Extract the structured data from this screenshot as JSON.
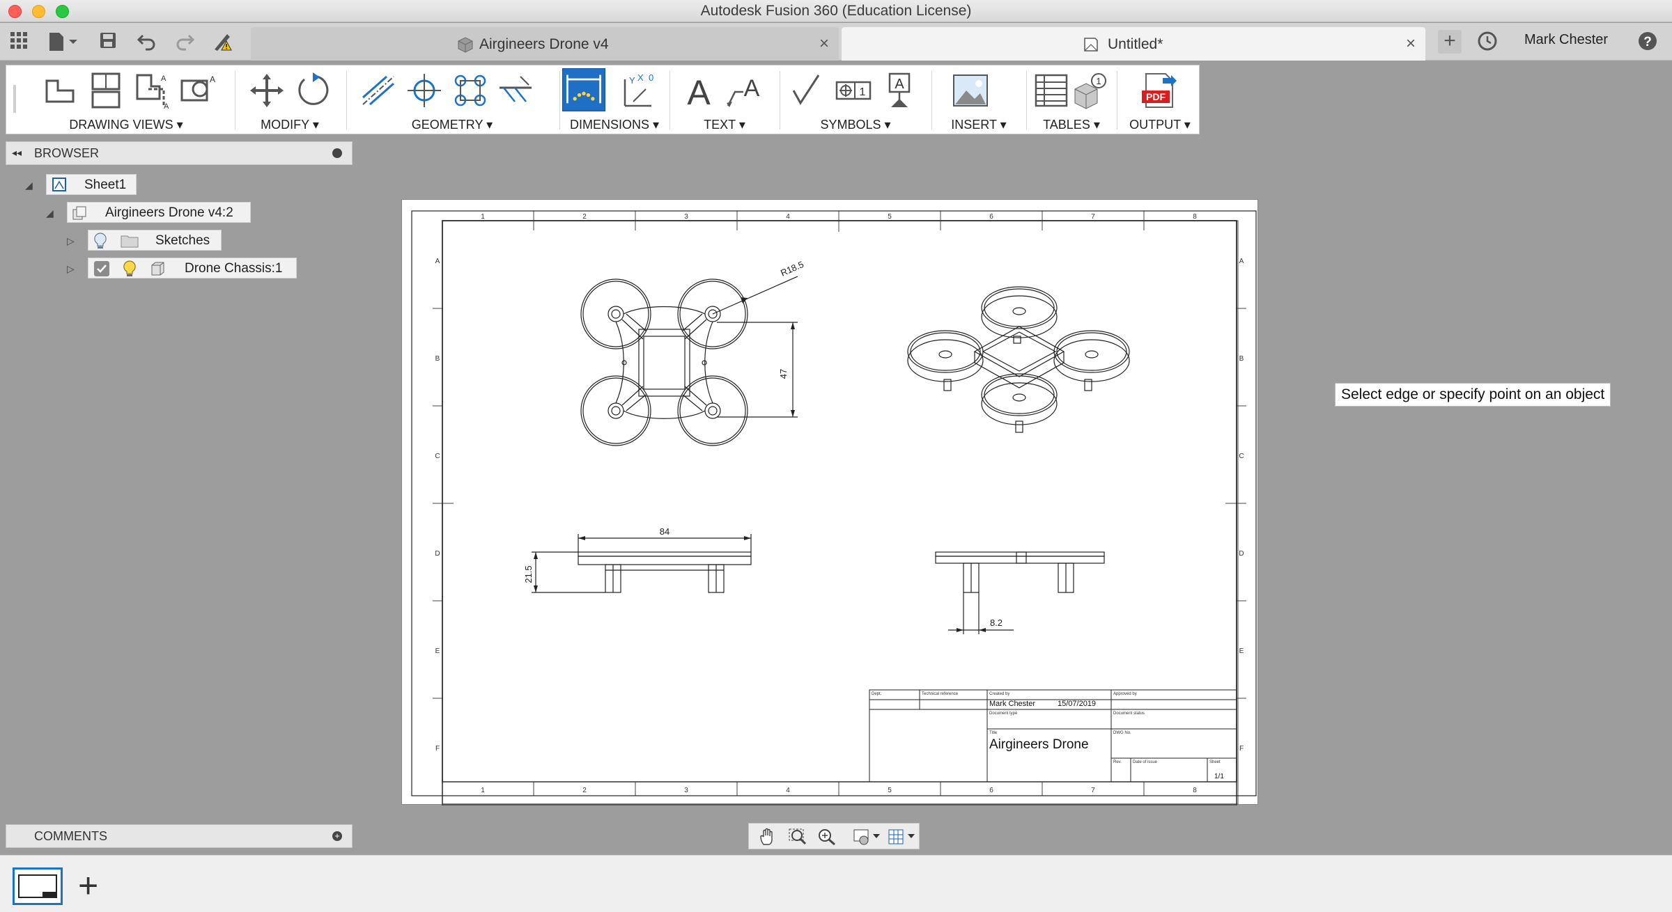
{
  "window": {
    "title": "Autodesk Fusion 360 (Education License)"
  },
  "tabs": [
    {
      "label": "Airgineers Drone v4",
      "active": false
    },
    {
      "label": "Untitled*",
      "active": true
    }
  ],
  "user": {
    "name": "Mark Chester"
  },
  "toolbar": {
    "groups": [
      {
        "label": "DRAWING VIEWS ▾"
      },
      {
        "label": "MODIFY ▾"
      },
      {
        "label": "GEOMETRY ▾"
      },
      {
        "label": "DIMENSIONS ▾"
      },
      {
        "label": "TEXT ▾"
      },
      {
        "label": "SYMBOLS ▾"
      },
      {
        "label": "INSERT ▾"
      },
      {
        "label": "TABLES ▾"
      },
      {
        "label": "OUTPUT ▾"
      }
    ],
    "pdf_label": "PDF",
    "text_glyph": "A"
  },
  "browser": {
    "title": "BROWSER",
    "nodes": [
      {
        "label": "Sheet1"
      },
      {
        "label": "Airgineers Drone v4:2"
      },
      {
        "label": "Sketches"
      },
      {
        "label": "Drone Chassis:1"
      }
    ]
  },
  "comments": {
    "title": "COMMENTS"
  },
  "tooltip": "Select edge or specify point on an object",
  "sheet": {
    "col_numbers": [
      "1",
      "2",
      "3",
      "4",
      "5",
      "6",
      "7",
      "8"
    ],
    "row_letters": [
      "A",
      "B",
      "C",
      "D",
      "E",
      "F"
    ],
    "dimensions": {
      "radius": "R18.5",
      "height_top": "47",
      "width_front": "84",
      "height_front": "21.5",
      "leg_width": "8.2"
    },
    "title_block": {
      "dept_label": "Dept.",
      "techref_label": "Technical reference",
      "createdby_label": "Created by",
      "approvedby_label": "Approved by",
      "doctype_label": "Document type",
      "docstatus_label": "Document status",
      "title_label": "Title",
      "dwgno_label": "DWG No.",
      "rev_label": "Rev.",
      "dateofissue_label": "Date of issue",
      "sheet_label": "Sheet",
      "created_by": "Mark Chester",
      "date": "15/07/2019",
      "title": "Airgineers Drone",
      "sheet_number": "1/1"
    }
  },
  "colors": {
    "accent": "#1a73c9",
    "toolbar_bg": "#ffffff",
    "canvas_bg": "#9d9d9d",
    "highlight": "#2b7fd6"
  }
}
